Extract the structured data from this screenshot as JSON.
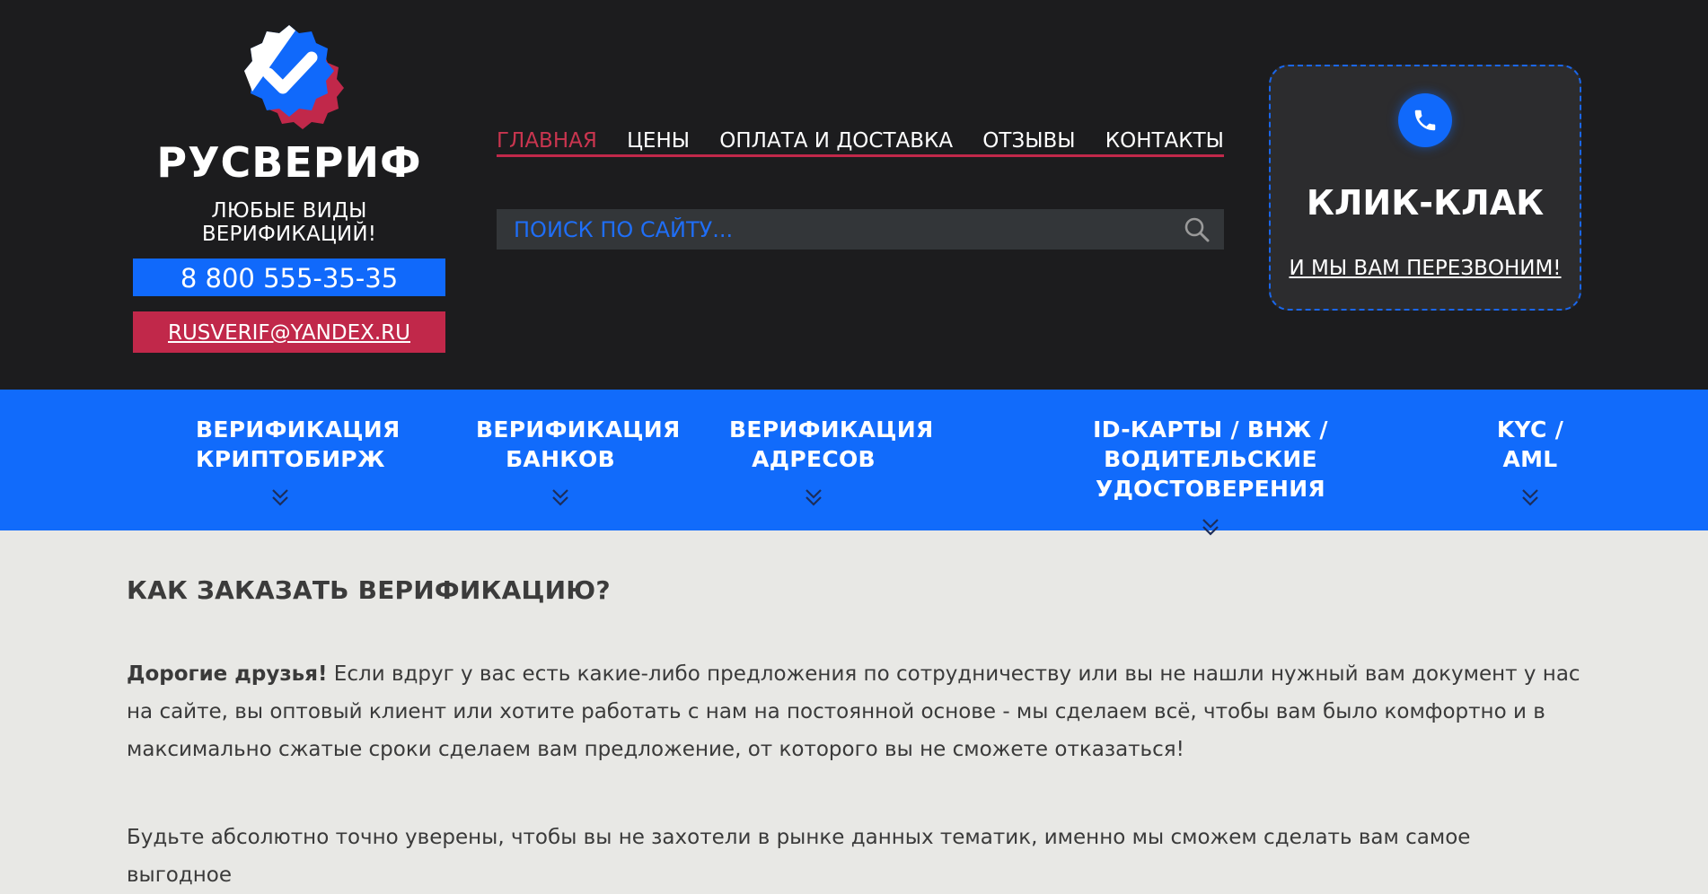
{
  "brand": {
    "name": "РУСВЕРИФ",
    "tagline": "ЛЮБЫЕ ВИДЫ ВЕРИФИКАЦИЙ!",
    "phone": "8 800 555-35-35",
    "email": "RUSVERIF@YANDEX.RU"
  },
  "nav": {
    "items": [
      {
        "label": "ГЛАВНАЯ"
      },
      {
        "label": "ЦЕНЫ"
      },
      {
        "label": "ОПЛАТА И ДОСТАВКА"
      },
      {
        "label": "ОТЗЫВЫ"
      },
      {
        "label": "КОНТАКТЫ"
      }
    ]
  },
  "search": {
    "placeholder": "ПОИСК ПО САЙТУ...",
    "value": ""
  },
  "callback": {
    "title": "КЛИК-КЛАК",
    "link": "И МЫ ВАМ ПЕРЕЗВОНИМ!"
  },
  "categories": [
    {
      "line1": "ВЕРИФИКАЦИЯ",
      "line2": "КРИПТОБИРЖ"
    },
    {
      "line1": "ВЕРИФИКАЦИЯ",
      "line2": "БАНКОВ"
    },
    {
      "line1": "ВЕРИФИКАЦИЯ",
      "line2": "АДРЕСОВ"
    },
    {
      "line1": "ID-КАРТЫ / ВНЖ / ВОДИТЕЛЬСКИЕ",
      "line2": "УДОСТОВЕРЕНИЯ"
    },
    {
      "line1": "KYC /",
      "line2": "AML"
    }
  ],
  "content": {
    "heading": "КАК ЗАКАЗАТЬ ВЕРИФИКАЦИЮ?",
    "p1_bold": "Дорогие друзья!",
    "p1_text": " Если вдруг у вас есть какие-либо предложения по сотрудничеству или вы не нашли нужный вам документ у нас на сайте, вы оптовый клиент или хотите работать с нам на постоянной основе - мы сделаем всё, чтобы вам было комфортно и в максимально сжатые сроки сделаем вам предложение, от которого вы не сможете отказаться!",
    "p2_text": "Будьте абсолютно точно уверены, чтобы вы не захотели в рынке данных тематик, именно мы сможем сделать вам самое выгодное"
  },
  "colors": {
    "header_bg": "#1c1c1e",
    "accent_blue": "#116bfb",
    "accent_red": "#c1284a",
    "content_bg": "#e8e8e5"
  }
}
